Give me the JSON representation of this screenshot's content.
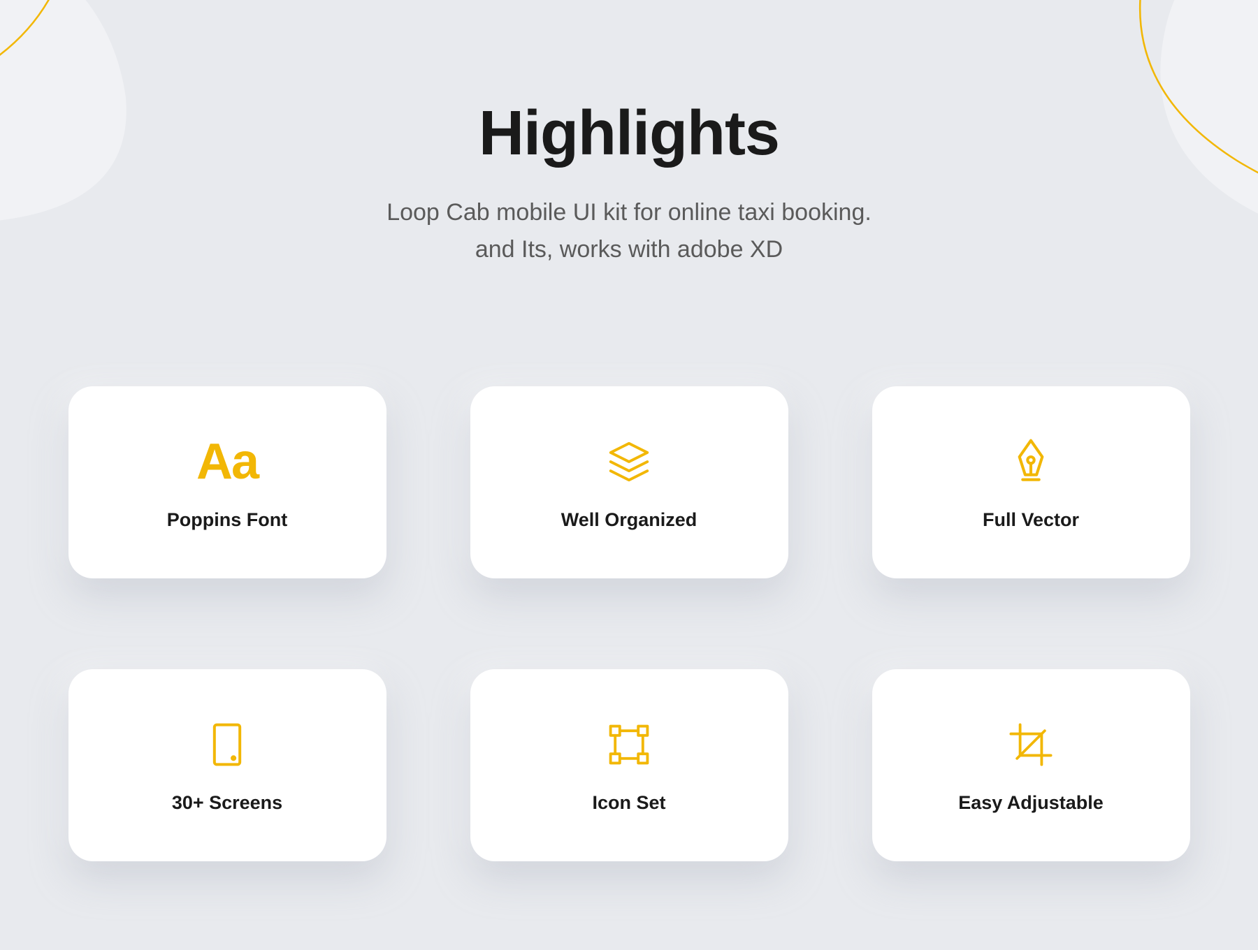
{
  "header": {
    "title": "Highlights",
    "subtitle_line1": "Loop Cab mobile UI kit for online taxi booking.",
    "subtitle_line2": "and Its, works with adobe XD"
  },
  "cards": [
    {
      "icon_label": "Aa",
      "label": "Poppins Font"
    },
    {
      "label": "Well Organized"
    },
    {
      "label": "Full Vector"
    },
    {
      "label": "30+ Screens"
    },
    {
      "label": "Icon Set"
    },
    {
      "label": "Easy Adjustable"
    }
  ],
  "colors": {
    "accent": "#F2B705"
  }
}
